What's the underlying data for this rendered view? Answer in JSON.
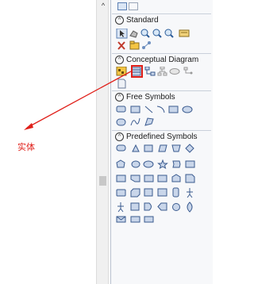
{
  "scrollbar": {
    "up_arrow": "^"
  },
  "sections": {
    "standard": {
      "toggle": "^",
      "label": "Standard"
    },
    "conceptual": {
      "toggle": "^",
      "label": "Conceptual Diagram"
    },
    "free": {
      "toggle": "^",
      "label": "Free Symbols"
    },
    "predefined": {
      "toggle": "^",
      "label": "Predefined Symbols"
    }
  },
  "annotation": {
    "text": "实体",
    "color": "#e0201a"
  },
  "colors": {
    "palette_bg": "#f7f8fa",
    "shape_fill": "#c9d6ea",
    "shape_stroke": "#3b5b8f"
  }
}
